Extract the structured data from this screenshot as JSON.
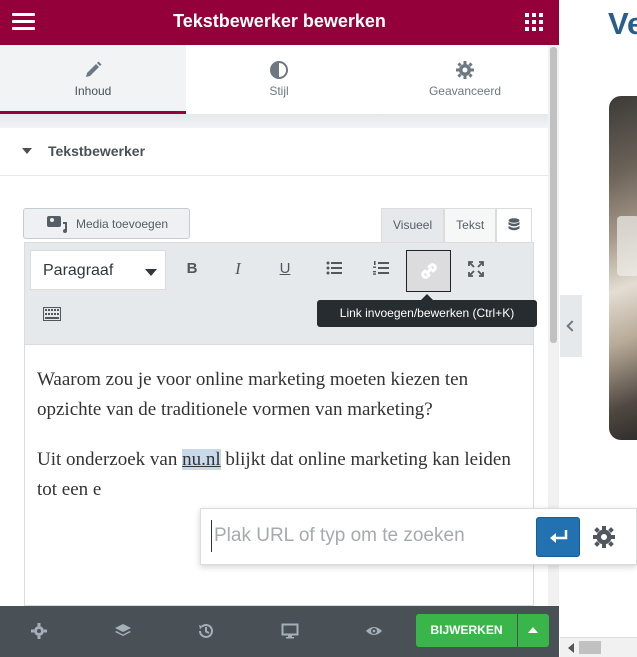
{
  "header": {
    "title": "Tekstbewerker bewerken",
    "menu_icon": "hamburger-icon",
    "apps_icon": "grid-icon"
  },
  "tabs": [
    {
      "label": "Inhoud",
      "icon": "pencil-icon",
      "active": true
    },
    {
      "label": "Stijl",
      "icon": "half-circle-icon",
      "active": false
    },
    {
      "label": "Geavanceerd",
      "icon": "gear-icon",
      "active": false
    }
  ],
  "section": {
    "title": "Tekstbewerker"
  },
  "media_button": {
    "label": "Media toevoegen",
    "icon": "media-icon"
  },
  "mode_tabs": {
    "visual": "Visueel",
    "text": "Tekst",
    "dynamic_icon": "database-icon"
  },
  "toolbar": {
    "format_select": "Paragraaf",
    "buttons": [
      "bold",
      "italic",
      "underline",
      "bullet-list",
      "numbered-list",
      "link",
      "fullscreen",
      "toolbar-toggle"
    ],
    "bold_glyph": "B",
    "italic_glyph": "I",
    "underline_glyph": "U",
    "active_button": "link"
  },
  "tooltip": {
    "text": "Link invoegen/bewerken (Ctrl+K)"
  },
  "editor": {
    "paragraph1": "Waarom zou je voor online marketing moeten kiezen ten opzichte van de traditionele vormen van marketing?",
    "paragraph2_before": "Uit onderzoek van ",
    "paragraph2_link": "nu.nl",
    "paragraph2_after": " blijkt dat online marketing kan leiden tot een e"
  },
  "link_popup": {
    "placeholder": "Plak URL of typ om te zoeken",
    "value": ""
  },
  "footer": {
    "update_label": "BIJWERKEN",
    "accent_color": "#39b54a"
  },
  "preview": {
    "heading_fragment": "Ve"
  },
  "colors": {
    "brand": "#93003a",
    "link_blue": "#2271b1"
  }
}
